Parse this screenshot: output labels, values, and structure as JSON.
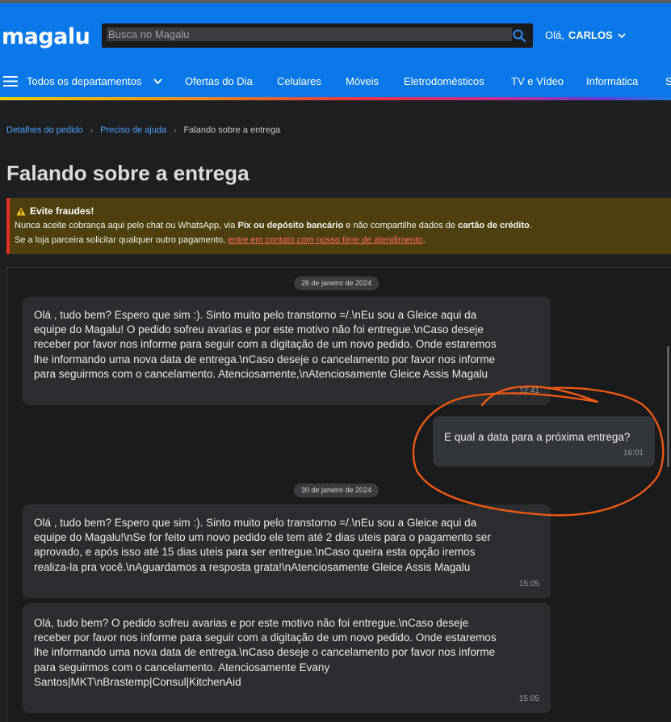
{
  "header": {
    "logo": "magalu",
    "search_placeholder": "Busca no Magalu",
    "greeting_prefix": "Olá,",
    "user_name": "CARLOS"
  },
  "nav": {
    "items": [
      "Todos os departamentos",
      "Ofertas do Dia",
      "Celulares",
      "Móveis",
      "Eletrodomésticos",
      "TV e Vídeo",
      "Informática",
      "S"
    ]
  },
  "breadcrumb": {
    "items": [
      "Detalhes do pedido",
      "Preciso de ajuda",
      "Falando sobre a entrega"
    ]
  },
  "page_title": "Falando sobre a entrega",
  "alert": {
    "title": "Evite fraudes!",
    "line1_a": "Nunca aceite cobrança aqui pelo chat ou WhatsApp, via ",
    "line1_b": "Pix ou depósito bancário",
    "line1_c": " e não compartilhe dados de ",
    "line1_d": "cartão de crédito",
    "line1_e": ".",
    "line2_a": "Se a loja parceira solicitar qualquer outro pagamento, ",
    "line2_link": "entre em contato com nosso time de atendimento",
    "line2_e": "."
  },
  "chat": {
    "date1": "26 de janeiro de 2024",
    "msg1": {
      "lines": [
        "Olá , tudo bem? Espero que sim :). Sinto muito pelo transtorno =/.\\nEu sou a Gleice aqui da",
        "equipe do Magalu! O pedido sofreu avarias e por este motivo não foi entregue.\\nCaso deseje",
        "receber por favor nos informe para seguir com a digitação de um novo pedido. Onde estaremos",
        "lhe informando uma nova data de entrega.\\nCaso deseje o cancelamento por favor nos informe",
        "para seguirmos com o cancelamento. Atenciosamente,\\nAtenciosamente Gleice Assis Magalu"
      ],
      "time": "12:41"
    },
    "msg2": {
      "text": "E qual a data para a próxima entrega?",
      "time": "16:01"
    },
    "date2": "30 de janeiro de 2024",
    "msg3": {
      "lines": [
        "Olá , tudo bem? Espero que sim :). Sinto muito pelo transtorno =/.\\nEu sou a Gleice aqui da",
        "equipe do Magalu!\\nSe for feito um novo pedido ele tem até 2 dias uteis para o pagamento ser",
        "aprovado, e após isso até 15 dias uteis para ser entregue.\\nCaso queira esta opção iremos",
        "realiza-la pra você.\\nAguardamos a resposta grata!\\nAtenciosamente Gleice Assis Magalu"
      ],
      "time": "15:05"
    },
    "msg4": {
      "lines": [
        "Olá, tudo bem? O pedido sofreu avarias e por este motivo não foi entregue.\\nCaso deseje",
        "receber por favor nos informe para seguir com a digitação de um novo pedido. Onde estaremos",
        "lhe informando uma nova data de entrega.\\nCaso deseje o cancelamento por favor nos informe",
        "para seguirmos com o cancelamento. Atenciosamente Evany",
        "Santos|MKT\\nBrastemp|Consul|KitchenAid"
      ],
      "time": "15:05"
    }
  },
  "colors": {
    "header_blue": "#0a78e8",
    "alert_bg": "#4d400e",
    "link_blue": "#4da3ff",
    "annotation_orange": "#f25a12"
  }
}
